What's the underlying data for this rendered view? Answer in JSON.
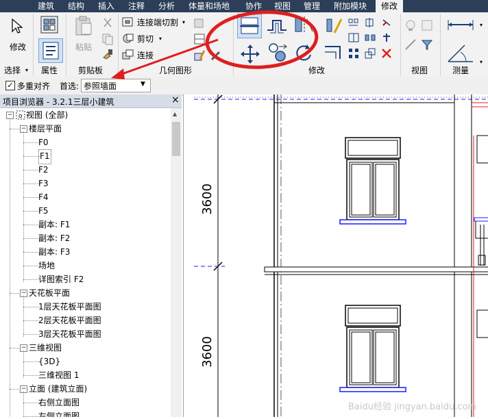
{
  "tabs": [
    "建筑",
    "结构",
    "插入",
    "注释",
    "分析",
    "体量和场地",
    "协作",
    "视图",
    "管理",
    "附加模块",
    "修改"
  ],
  "ribbon": {
    "modify_label": "修改",
    "paste_label": "粘贴",
    "join_cut_label": "连接端切割",
    "cut_label": "剪切",
    "join_label": "连接",
    "panels": {
      "select": "选择",
      "properties": "属性",
      "clipboard": "剪贴板",
      "geometry": "几何图形",
      "modify": "修改",
      "view": "视图",
      "measure": "测量"
    }
  },
  "options_bar": {
    "multi_align_label": "多重对齐",
    "multi_align_checked": true,
    "prefer_label": "首选:",
    "prefer_value": "参照墙面"
  },
  "browser": {
    "title": "项目浏览器 - 3.2.1三层小建筑",
    "close": "×",
    "items": [
      {
        "label": "视图 (全部)",
        "level": 0,
        "expanded": true
      },
      {
        "label": "楼层平面",
        "level": 1,
        "expanded": true
      },
      {
        "label": "F0",
        "level": 2
      },
      {
        "label": "F1",
        "level": 2,
        "selected": true
      },
      {
        "label": "F2",
        "level": 2
      },
      {
        "label": "F3",
        "level": 2
      },
      {
        "label": "F4",
        "level": 2
      },
      {
        "label": "F5",
        "level": 2
      },
      {
        "label": "副本: F1",
        "level": 2
      },
      {
        "label": "副本: F2",
        "level": 2
      },
      {
        "label": "副本: F3",
        "level": 2
      },
      {
        "label": "场地",
        "level": 2
      },
      {
        "label": "详图索引 F2",
        "level": 2
      },
      {
        "label": "天花板平面",
        "level": 1,
        "expanded": true
      },
      {
        "label": "1层天花板平面图",
        "level": 2
      },
      {
        "label": "2层天花板平面图",
        "level": 2
      },
      {
        "label": "3层天花板平面图",
        "level": 2
      },
      {
        "label": "三维视图",
        "level": 1,
        "expanded": true
      },
      {
        "label": "{3D}",
        "level": 2
      },
      {
        "label": "三维视图 1",
        "level": 2
      },
      {
        "label": "立面 (建筑立面)",
        "level": 1,
        "expanded": true
      },
      {
        "label": "右侧立面图",
        "level": 2
      },
      {
        "label": "左侧立面图",
        "level": 2
      }
    ]
  },
  "drawing": {
    "dim_upper": "3600",
    "dim_lower": "3600"
  },
  "watermark": "Baidu经验 jingyan.baidu.com",
  "colors": {
    "tabbar": "#2c3e58",
    "annotation_red": "#e01e1e",
    "window_blue": "#1a1aff",
    "selected_bg": "#cfe1f5"
  }
}
